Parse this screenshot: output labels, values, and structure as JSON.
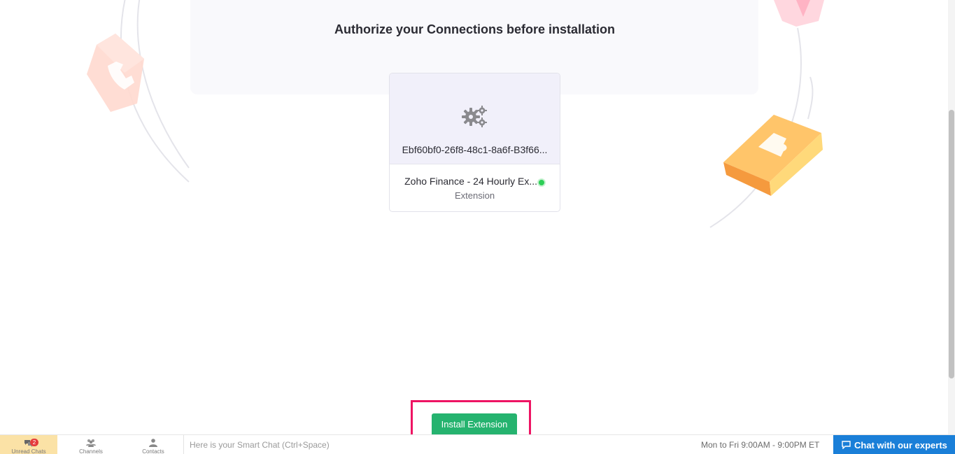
{
  "header": {
    "title": "Authorize your Connections before installation"
  },
  "connection_card": {
    "connection_id": "Ebf60bf0-26f8-48c1-8a6f-B3f66...",
    "extension_name": "Zoho Finance - 24 Hourly Ex...",
    "extension_type": "Extension",
    "status_color": "#2ecf57"
  },
  "actions": {
    "install_label": "Install Extension"
  },
  "bottom_bar": {
    "tabs": [
      {
        "label": "Unread Chats",
        "badge": "2",
        "icon": "chat-bubbles-icon"
      },
      {
        "label": "Channels",
        "icon": "users-group-icon"
      },
      {
        "label": "Contacts",
        "icon": "person-icon"
      }
    ],
    "smart_chat_placeholder": "Here is your Smart Chat (Ctrl+Space)",
    "support_hours": "Mon to Fri 9:00AM - 9:00PM ET",
    "chat_button_label": "Chat with our experts"
  },
  "colors": {
    "accent_green": "#25b36f",
    "highlight_pink": "#ee1463",
    "chat_blue": "#1a7fd8",
    "unread_tab_bg": "#fbe2a6"
  }
}
